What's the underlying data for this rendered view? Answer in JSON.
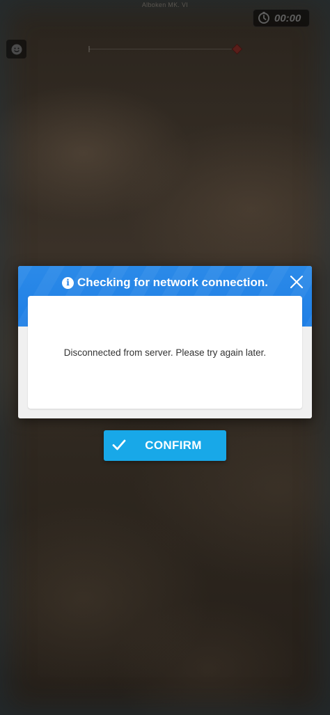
{
  "header": {
    "mech_name": "Alboken MK. VI",
    "timer_value": "00:00"
  },
  "icons": {
    "timer": "clock-icon",
    "emote": "smiley-icon",
    "info": "info-icon",
    "close": "close-icon",
    "confirm": "check-icon"
  },
  "dialog": {
    "info_glyph": "i",
    "title": "Checking for network connection.",
    "message": "Disconnected from server. Please try again later.",
    "confirm_label": "CONFIRM"
  },
  "colors": {
    "header_blue": "#1f7fe6",
    "confirm_blue": "#18a8e8",
    "background": "#2e271f"
  }
}
